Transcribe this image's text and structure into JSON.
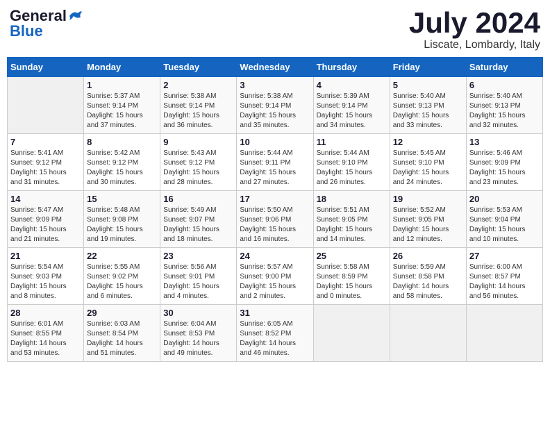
{
  "header": {
    "logo_general": "General",
    "logo_blue": "Blue",
    "month_title": "July 2024",
    "subtitle": "Liscate, Lombardy, Italy"
  },
  "calendar": {
    "days_of_week": [
      "Sunday",
      "Monday",
      "Tuesday",
      "Wednesday",
      "Thursday",
      "Friday",
      "Saturday"
    ],
    "weeks": [
      [
        {
          "day": "",
          "info": ""
        },
        {
          "day": "1",
          "info": "Sunrise: 5:37 AM\nSunset: 9:14 PM\nDaylight: 15 hours\nand 37 minutes."
        },
        {
          "day": "2",
          "info": "Sunrise: 5:38 AM\nSunset: 9:14 PM\nDaylight: 15 hours\nand 36 minutes."
        },
        {
          "day": "3",
          "info": "Sunrise: 5:38 AM\nSunset: 9:14 PM\nDaylight: 15 hours\nand 35 minutes."
        },
        {
          "day": "4",
          "info": "Sunrise: 5:39 AM\nSunset: 9:14 PM\nDaylight: 15 hours\nand 34 minutes."
        },
        {
          "day": "5",
          "info": "Sunrise: 5:40 AM\nSunset: 9:13 PM\nDaylight: 15 hours\nand 33 minutes."
        },
        {
          "day": "6",
          "info": "Sunrise: 5:40 AM\nSunset: 9:13 PM\nDaylight: 15 hours\nand 32 minutes."
        }
      ],
      [
        {
          "day": "7",
          "info": "Sunrise: 5:41 AM\nSunset: 9:12 PM\nDaylight: 15 hours\nand 31 minutes."
        },
        {
          "day": "8",
          "info": "Sunrise: 5:42 AM\nSunset: 9:12 PM\nDaylight: 15 hours\nand 30 minutes."
        },
        {
          "day": "9",
          "info": "Sunrise: 5:43 AM\nSunset: 9:12 PM\nDaylight: 15 hours\nand 28 minutes."
        },
        {
          "day": "10",
          "info": "Sunrise: 5:44 AM\nSunset: 9:11 PM\nDaylight: 15 hours\nand 27 minutes."
        },
        {
          "day": "11",
          "info": "Sunrise: 5:44 AM\nSunset: 9:10 PM\nDaylight: 15 hours\nand 26 minutes."
        },
        {
          "day": "12",
          "info": "Sunrise: 5:45 AM\nSunset: 9:10 PM\nDaylight: 15 hours\nand 24 minutes."
        },
        {
          "day": "13",
          "info": "Sunrise: 5:46 AM\nSunset: 9:09 PM\nDaylight: 15 hours\nand 23 minutes."
        }
      ],
      [
        {
          "day": "14",
          "info": "Sunrise: 5:47 AM\nSunset: 9:09 PM\nDaylight: 15 hours\nand 21 minutes."
        },
        {
          "day": "15",
          "info": "Sunrise: 5:48 AM\nSunset: 9:08 PM\nDaylight: 15 hours\nand 19 minutes."
        },
        {
          "day": "16",
          "info": "Sunrise: 5:49 AM\nSunset: 9:07 PM\nDaylight: 15 hours\nand 18 minutes."
        },
        {
          "day": "17",
          "info": "Sunrise: 5:50 AM\nSunset: 9:06 PM\nDaylight: 15 hours\nand 16 minutes."
        },
        {
          "day": "18",
          "info": "Sunrise: 5:51 AM\nSunset: 9:05 PM\nDaylight: 15 hours\nand 14 minutes."
        },
        {
          "day": "19",
          "info": "Sunrise: 5:52 AM\nSunset: 9:05 PM\nDaylight: 15 hours\nand 12 minutes."
        },
        {
          "day": "20",
          "info": "Sunrise: 5:53 AM\nSunset: 9:04 PM\nDaylight: 15 hours\nand 10 minutes."
        }
      ],
      [
        {
          "day": "21",
          "info": "Sunrise: 5:54 AM\nSunset: 9:03 PM\nDaylight: 15 hours\nand 8 minutes."
        },
        {
          "day": "22",
          "info": "Sunrise: 5:55 AM\nSunset: 9:02 PM\nDaylight: 15 hours\nand 6 minutes."
        },
        {
          "day": "23",
          "info": "Sunrise: 5:56 AM\nSunset: 9:01 PM\nDaylight: 15 hours\nand 4 minutes."
        },
        {
          "day": "24",
          "info": "Sunrise: 5:57 AM\nSunset: 9:00 PM\nDaylight: 15 hours\nand 2 minutes."
        },
        {
          "day": "25",
          "info": "Sunrise: 5:58 AM\nSunset: 8:59 PM\nDaylight: 15 hours\nand 0 minutes."
        },
        {
          "day": "26",
          "info": "Sunrise: 5:59 AM\nSunset: 8:58 PM\nDaylight: 14 hours\nand 58 minutes."
        },
        {
          "day": "27",
          "info": "Sunrise: 6:00 AM\nSunset: 8:57 PM\nDaylight: 14 hours\nand 56 minutes."
        }
      ],
      [
        {
          "day": "28",
          "info": "Sunrise: 6:01 AM\nSunset: 8:55 PM\nDaylight: 14 hours\nand 53 minutes."
        },
        {
          "day": "29",
          "info": "Sunrise: 6:03 AM\nSunset: 8:54 PM\nDaylight: 14 hours\nand 51 minutes."
        },
        {
          "day": "30",
          "info": "Sunrise: 6:04 AM\nSunset: 8:53 PM\nDaylight: 14 hours\nand 49 minutes."
        },
        {
          "day": "31",
          "info": "Sunrise: 6:05 AM\nSunset: 8:52 PM\nDaylight: 14 hours\nand 46 minutes."
        },
        {
          "day": "",
          "info": ""
        },
        {
          "day": "",
          "info": ""
        },
        {
          "day": "",
          "info": ""
        }
      ]
    ]
  }
}
